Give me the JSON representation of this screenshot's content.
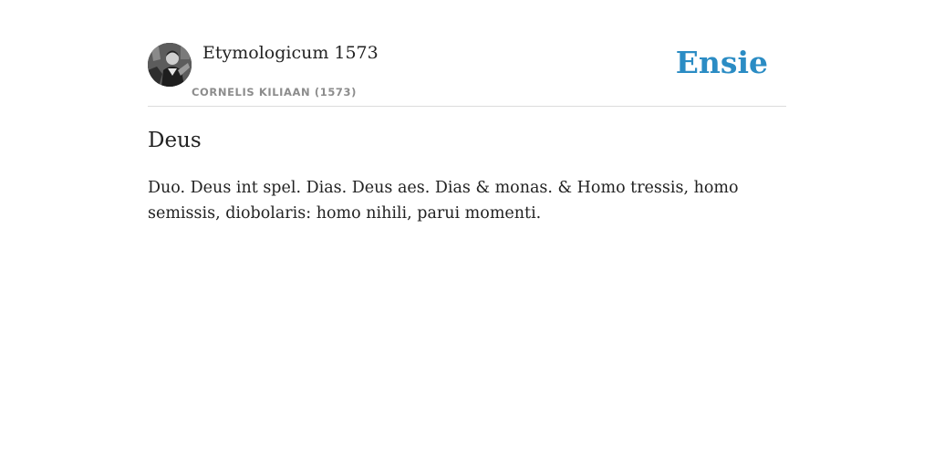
{
  "header": {
    "dictionary_title": "Etymologicum 1573",
    "author": "CORNELIS KILIAAN (1573)",
    "logo": "Ensie",
    "avatar_icon": "portrait-icon"
  },
  "entry": {
    "headword": "Deus",
    "definition": "Duo. Deus int spel. Dias. Deus aes. Dias & monas. & Homo tressis, homo semissis, diobolaris: homo nihili, parui momenti."
  },
  "colors": {
    "brand": "#2b8cc4",
    "muted_text": "#8c8c8c",
    "divider": "#dcdcdc"
  }
}
